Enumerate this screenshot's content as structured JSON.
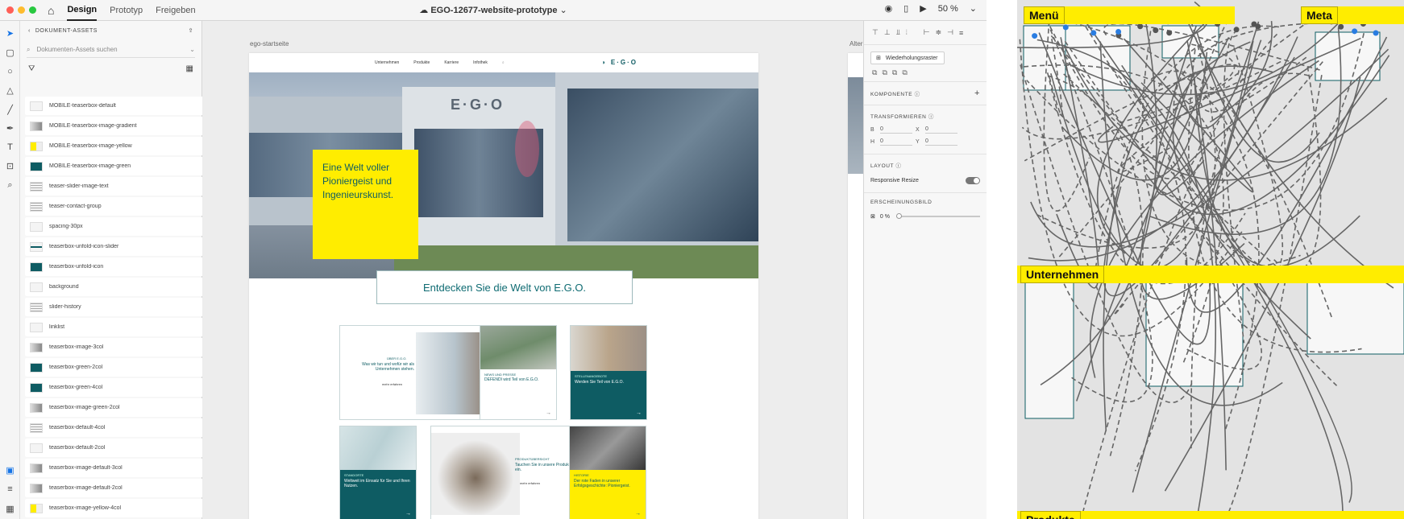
{
  "topbar": {
    "tabs": [
      "Design",
      "Prototyp",
      "Freigeben"
    ],
    "doc_title": "EGO-12677-website-prototype",
    "zoom": "50 %",
    "traffic_colors": [
      "#ff5f57",
      "#febc2e",
      "#28c840"
    ]
  },
  "assets": {
    "title": "DOKUMENT-ASSETS",
    "search_placeholder": "Dokumenten-Assets suchen",
    "items": [
      {
        "label": "MOBILE-teaserbox-default",
        "thumb": "white"
      },
      {
        "label": "MOBILE-teaserbox-image-gradient",
        "thumb": "image"
      },
      {
        "label": "MOBILE-teaserbox-image-yellow",
        "thumb": "yellow"
      },
      {
        "label": "MOBILE-teaserbox-image-green",
        "thumb": "green"
      },
      {
        "label": "teaser-slider-image-text",
        "thumb": "lines"
      },
      {
        "label": "teaser-contact-group",
        "thumb": "lines"
      },
      {
        "label": "spacing-30px",
        "thumb": "white"
      },
      {
        "label": "teaserbox-unfold-icon-slider",
        "thumb": "greenline"
      },
      {
        "label": "teaserbox-unfold-icon",
        "thumb": "green"
      },
      {
        "label": "background",
        "thumb": "white"
      },
      {
        "label": "slider-history",
        "thumb": "lines"
      },
      {
        "label": "linklist",
        "thumb": "white"
      },
      {
        "label": "teaserbox-image-3col",
        "thumb": "image"
      },
      {
        "label": "teaserbox-green-2col",
        "thumb": "green"
      },
      {
        "label": "teaserbox-green-4col",
        "thumb": "green"
      },
      {
        "label": "teaserbox-image-green-2col",
        "thumb": "image"
      },
      {
        "label": "teaserbox-default-4col",
        "thumb": "lines"
      },
      {
        "label": "teaserbox-default-2col",
        "thumb": "white"
      },
      {
        "label": "teaserbox-image-default-3col",
        "thumb": "image"
      },
      {
        "label": "teaserbox-image-default-2col",
        "thumb": "image"
      },
      {
        "label": "teaserbox-image-yellow-4col",
        "thumb": "yellow"
      }
    ]
  },
  "canvas": {
    "artboard_label": "ego-startseite",
    "artboard_label2": "Alter",
    "nav": [
      "Unternehmen",
      "Produkte",
      "Karriere",
      "Infothek"
    ],
    "logo": "E·G·O",
    "building_logo": "E·G·O",
    "hero_text": "Eine Welt voller Pioniergeist und Ingenieurskunst.",
    "discover_text": "Entdecken Sie die Welt von E.G.O.",
    "tiles": {
      "t1_kicker": "ÜBER E.G.O.",
      "t1_text": "Was wir tun und wofür wir als Unternehmen stehen.",
      "t1_link": "mehr erfahren",
      "t2_kicker": "NEWS UND PRESSE",
      "t2_text": "DEFENDI wird Teil von E.G.O.",
      "t3_kicker": "STELLENANGEBOTE",
      "t3_text": "Werden Sie Teil von E.G.O.",
      "t4_kicker": "STANDORTE",
      "t4_text": "Weltweit im Einsatz für Sie und Ihren Nutzen.",
      "t5_kicker": "PRODUKTÜBERSICHT",
      "t5_text": "Tauchen Sie in unsere Produktwelt ein.",
      "t5_link": "mehr erfahren",
      "t6_kicker": "HISTORIE",
      "t6_text": "Der rote Faden in unserer Erfolgsgeschichte: Pioniergeist."
    },
    "colors": {
      "teal": "#0e5c63",
      "yellow": "#ffed00"
    }
  },
  "props": {
    "repeat_grid": "Wiederholungsraster",
    "komponente": "KOMPONENTE",
    "transform": "TRANSFORMIEREN",
    "w_label": "B",
    "w_val": "0",
    "x_label": "X",
    "x_val": "0",
    "h_label": "H",
    "h_val": "0",
    "y_label": "Y",
    "y_val": "0",
    "layout": "LAYOUT",
    "responsive": "Responsive Resize",
    "appearance": "ERSCHEINUNGSBILD",
    "opacity": "0 %"
  },
  "wiring": {
    "labels": [
      "Menü",
      "Meta",
      "Unternehmen",
      "Produkte"
    ]
  }
}
